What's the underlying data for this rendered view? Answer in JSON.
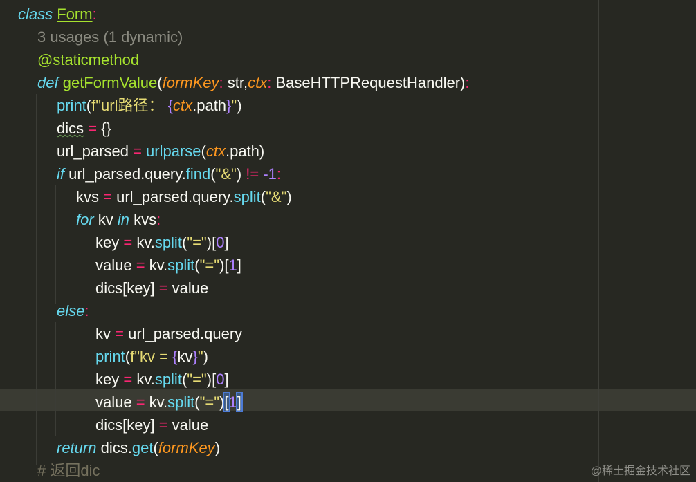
{
  "lines": {
    "l1": {
      "kw": "class",
      "name": "Form",
      "colon": ":"
    },
    "l2": {
      "hint": "3 usages (1 dynamic)"
    },
    "l3": {
      "dec": "@staticmethod"
    },
    "l4": {
      "kw": "def",
      "name": "getFormValue",
      "open": "(",
      "p1": "formKey",
      "c1": ":",
      "t1": " str,",
      "p2": "ctx",
      "c2": ":",
      "t2": " BaseHTTPRequestHandler",
      "close": ")",
      "colon": ":"
    },
    "l5": {
      "fn": "print",
      "open": "(",
      "fpre": "f\"url路径：",
      "sp": " ",
      "lb": "{",
      "p": "ctx",
      "attr": ".path",
      "rb": "}",
      "q": "\"",
      "close": ")"
    },
    "l6": {
      "v": "dics",
      "eq": " = ",
      "val": "{}"
    },
    "l7": {
      "v": "url_parsed",
      "eq": " = ",
      "fn": "urlparse",
      "open": "(",
      "p": "ctx",
      "rest": ".path)"
    },
    "l8": {
      "kw": "if",
      "a": " url_parsed.query.",
      "fn": "find",
      "open": "(",
      "s": "\"&\"",
      "close": ")",
      "op": " != ",
      "num": "-1",
      "colon": ":"
    },
    "l9": {
      "v": "kvs",
      "eq": " = ",
      "a": "url_parsed.query.",
      "fn": "split",
      "open": "(",
      "s": "\"&\"",
      "close": ")"
    },
    "l10": {
      "kw": "for",
      "a": " kv ",
      "kw2": "in",
      "b": " kvs",
      "colon": ":"
    },
    "l11": {
      "v": "key",
      "eq": " = ",
      "a": "kv.",
      "fn": "split",
      "open": "(",
      "s": "\"=\"",
      "close": ")",
      "lb": "[",
      "num": "0",
      "rb": "]"
    },
    "l12": {
      "v": "value",
      "eq": " = ",
      "a": "kv.",
      "fn": "split",
      "open": "(",
      "s": "\"=\"",
      "close": ")",
      "lb": "[",
      "num": "1",
      "rb": "]"
    },
    "l13": {
      "v": "dics[key]",
      "eq": " = ",
      "val": "value"
    },
    "l14": {
      "kw": "else",
      "colon": ":"
    },
    "l15": {
      "v": "kv",
      "eq": " = ",
      "val": "url_parsed.query"
    },
    "l16": {
      "fn": "print",
      "open": "(",
      "fpre": "f\"kv = ",
      "lb": "{",
      "p": "kv",
      "rb": "}",
      "q": "\"",
      "close": ")"
    },
    "l17": {
      "v": "key",
      "eq": " = ",
      "a": "kv.",
      "fn": "split",
      "open": "(",
      "s": "\"=\"",
      "close": ")",
      "lb": "[",
      "num": "0",
      "rb": "]"
    },
    "l18": {
      "v": "value",
      "eq": " = ",
      "a": "kv.",
      "fn": "split",
      "open": "(",
      "s": "\"=\"",
      "close": ")",
      "lb": "[",
      "num": "1",
      "rb": "]"
    },
    "l19": {
      "v": "dics[key]",
      "eq": " = ",
      "val": "value"
    },
    "l20": {
      "kw": "return",
      "a": " dics.",
      "fn": "get",
      "open": "(",
      "p": "formKey",
      "close": ")"
    },
    "l21": {
      "comment": "# 返回dic"
    }
  },
  "watermark": "@稀土掘金技术社区",
  "colors": {
    "background": "#272822",
    "keyword": "#66d9ef",
    "function": "#a6e22e",
    "param": "#fd971f",
    "operator": "#f92672",
    "number": "#ae81ff",
    "string": "#e6db74",
    "comment": "#75715e"
  }
}
